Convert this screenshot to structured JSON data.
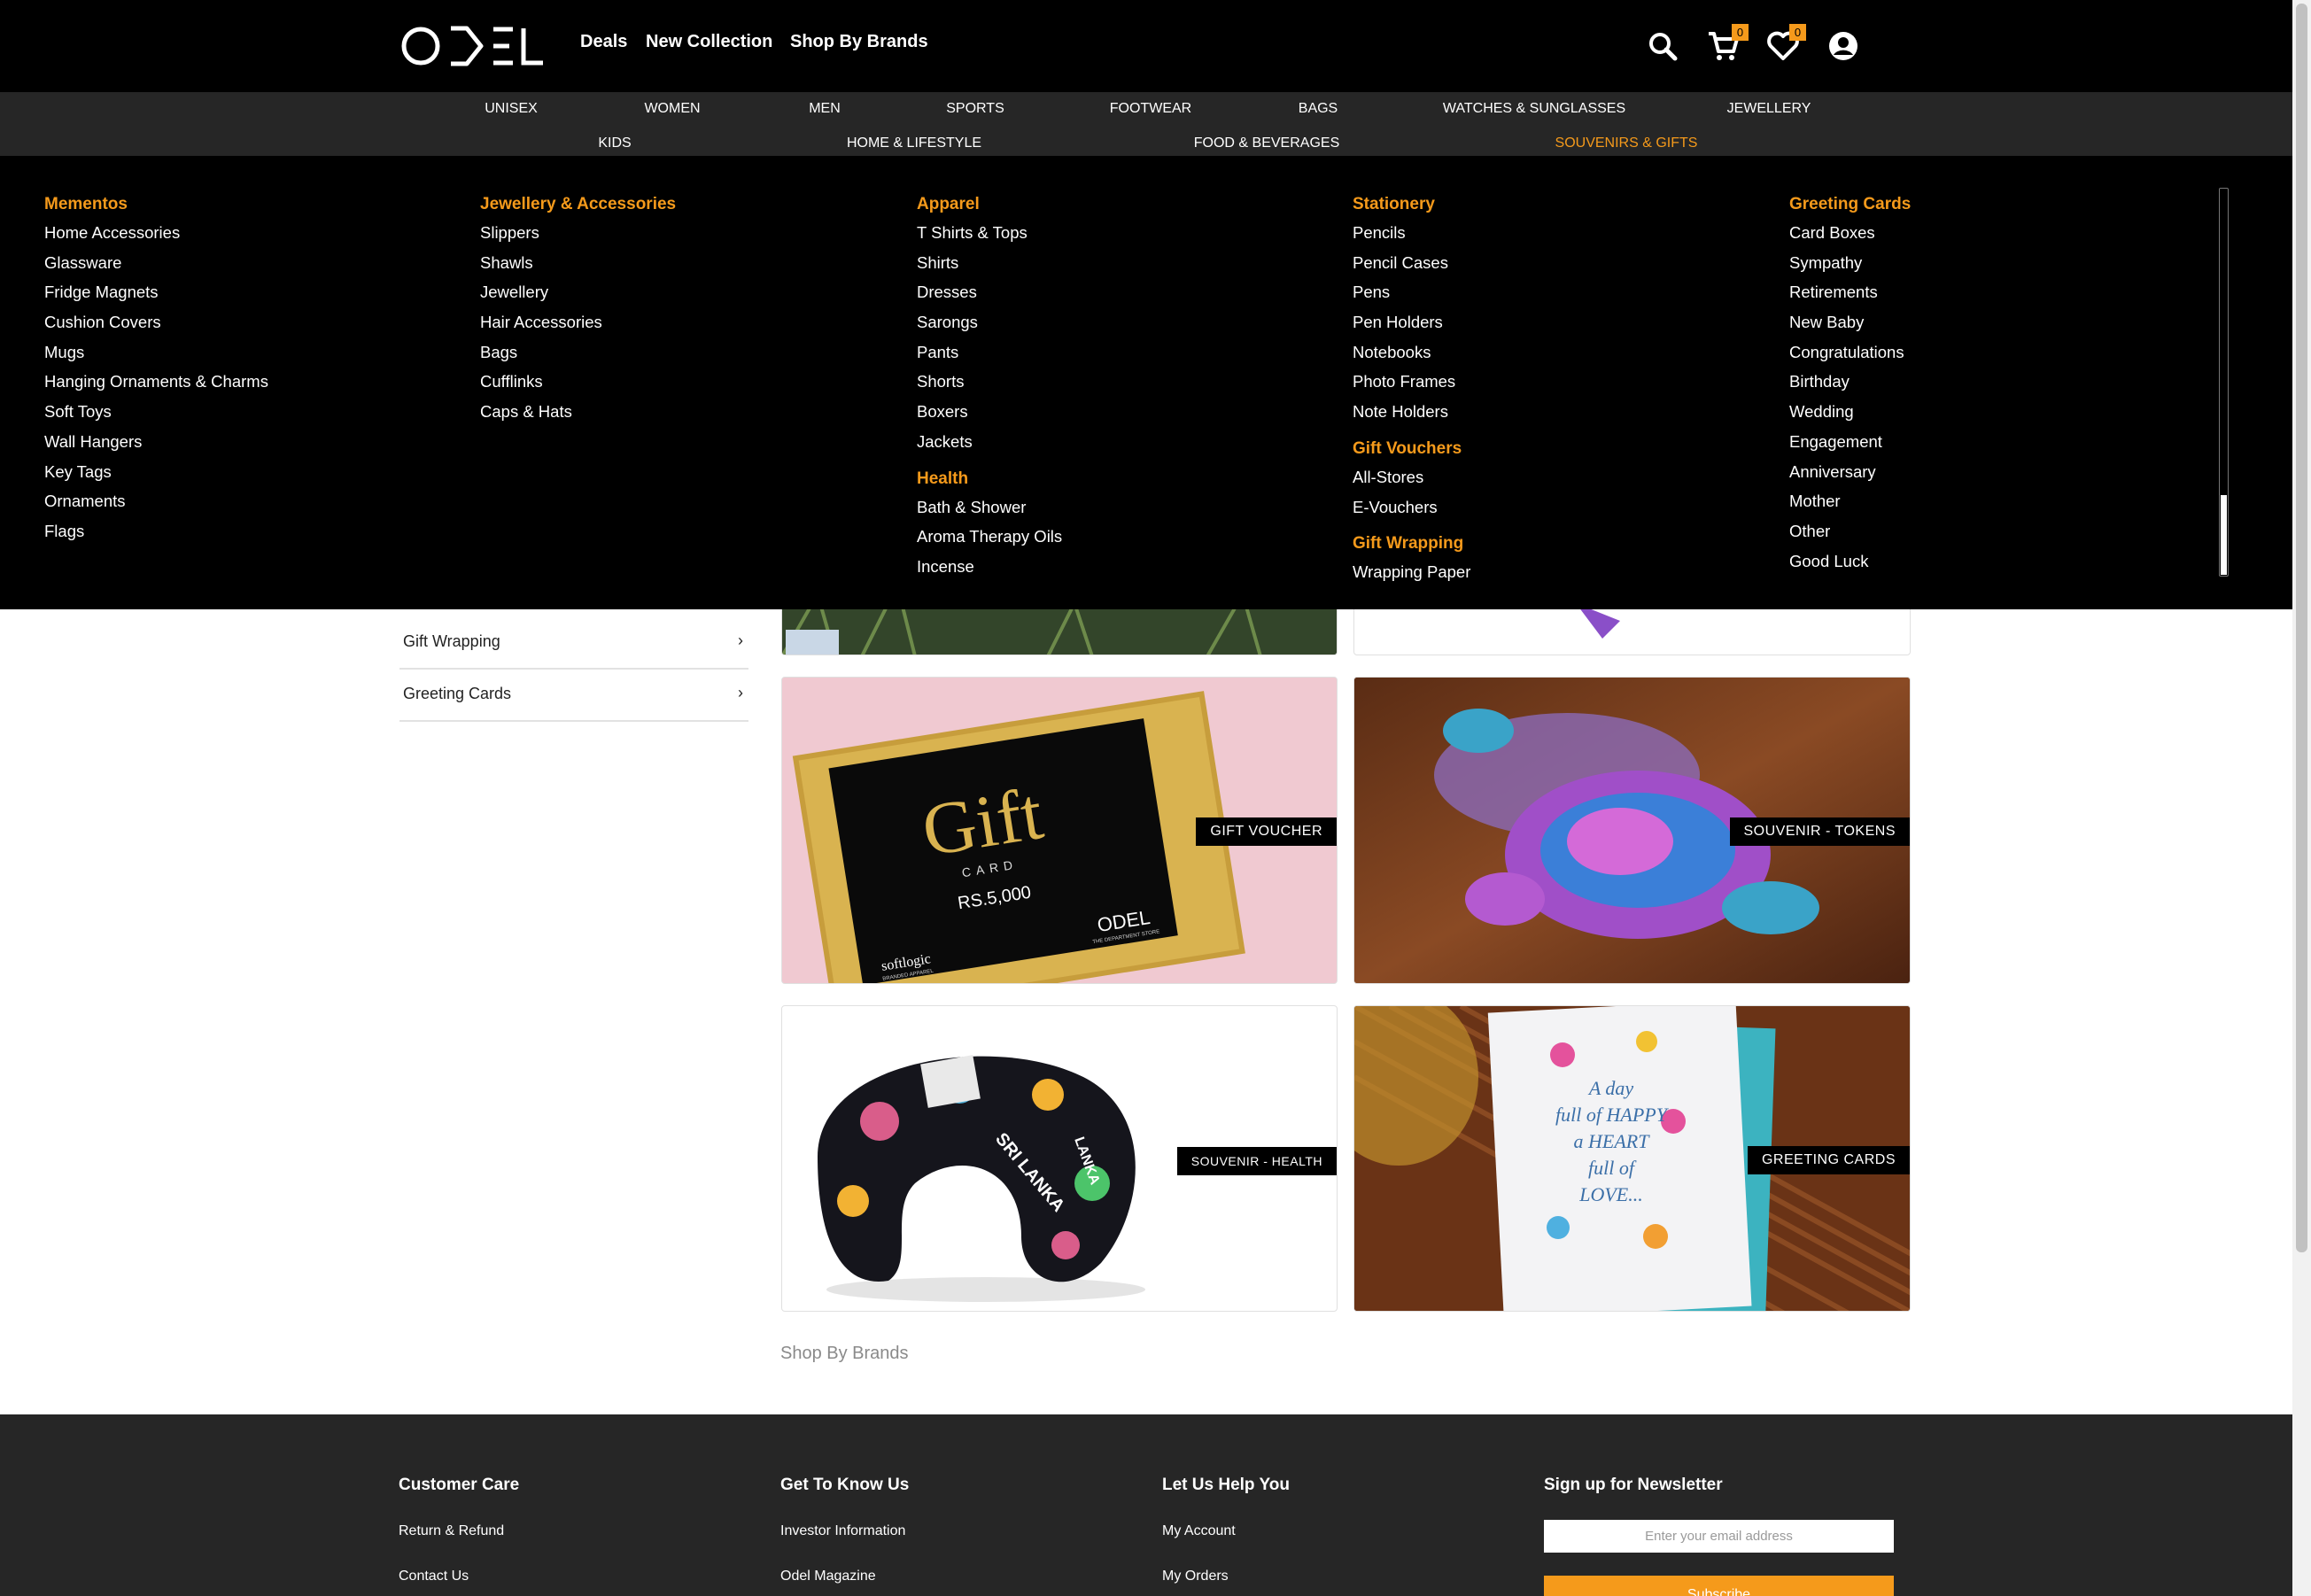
{
  "header": {
    "nav": [
      "Deals",
      "New Collection",
      "Shop By Brands"
    ],
    "cart_count": "0",
    "wishlist_count": "0",
    "icons": [
      "logo",
      "search-icon",
      "cart-icon",
      "heart-icon",
      "user-icon"
    ]
  },
  "categories": {
    "row1": [
      "UNISEX",
      "WOMEN",
      "MEN",
      "SPORTS",
      "FOOTWEAR",
      "BAGS",
      "WATCHES & SUNGLASSES",
      "JEWELLERY"
    ],
    "row2": [
      "KIDS",
      "HOME & LIFESTYLE",
      "FOOD & BEVERAGES",
      "SOUVENIRS & GIFTS"
    ],
    "active": "SOUVENIRS & GIFTS"
  },
  "mega_menu": {
    "col1": {
      "groups": [
        {
          "title": "Mementos",
          "items": [
            "Home Accessories",
            "Glassware",
            "Fridge Magnets",
            "Cushion Covers",
            "Mugs",
            "Hanging Ornaments & Charms",
            "Soft Toys",
            "Wall Hangers",
            "Key Tags",
            "Ornaments",
            "Flags"
          ]
        }
      ]
    },
    "col2": {
      "groups": [
        {
          "title": "Jewellery & Accessories",
          "items": [
            "Slippers",
            "Shawls",
            "Jewellery",
            "Hair Accessories",
            "Bags",
            "Cufflinks",
            "Caps & Hats"
          ]
        }
      ]
    },
    "col3": {
      "groups": [
        {
          "title": "Apparel",
          "items": [
            "T Shirts & Tops",
            "Shirts",
            "Dresses",
            "Sarongs",
            "Pants",
            "Shorts",
            "Boxers",
            "Jackets"
          ]
        },
        {
          "title": "Health",
          "items": [
            "Bath & Shower",
            "Aroma Therapy Oils",
            "Incense"
          ]
        }
      ]
    },
    "col4": {
      "groups": [
        {
          "title": "Stationery",
          "items": [
            "Pencils",
            "Pencil Cases",
            "Pens",
            "Pen Holders",
            "Notebooks",
            "Photo Frames",
            "Note Holders"
          ]
        },
        {
          "title": "Gift Vouchers",
          "items": [
            "All-Stores",
            "E-Vouchers"
          ]
        },
        {
          "title": "Gift Wrapping",
          "items": [
            "Wrapping Paper"
          ]
        }
      ]
    },
    "col5": {
      "groups": [
        {
          "title": "Greeting Cards",
          "items": [
            "Card Boxes",
            "Sympathy",
            "Retirements",
            "New Baby",
            "Congratulations",
            "Birthday",
            "Wedding",
            "Engagement",
            "Anniversary",
            "Mother",
            "Other",
            "Good Luck"
          ]
        }
      ]
    }
  },
  "sidebar": {
    "items": [
      {
        "label": "Gift Wrapping",
        "chevron": "›"
      },
      {
        "label": "Greeting Cards",
        "chevron": "›"
      }
    ]
  },
  "tiles": [
    {
      "label": "GIFT VOUCHER"
    },
    {
      "label": "SOUVENIR - TOKENS"
    },
    {
      "label": "SOUVENIR - HEALTH"
    },
    {
      "label": "GREETING CARDS"
    }
  ],
  "image_text": {
    "gift_card": {
      "word": "Gift",
      "sub": "CARD",
      "amount": "RS.5,000",
      "brand": "ODEL",
      "brand_sub": "THE DEPARTMENT STORE",
      "maker": "softlogic",
      "maker_sub": "BRANDED APPAREL"
    },
    "pillow": {
      "text1": "SRI LANKA",
      "text2": "LANKA"
    },
    "greeting": {
      "line1": "A day",
      "line2": "full of HAPPY",
      "line3": "a HEART",
      "line4": "full of",
      "line5": "LOVE..."
    }
  },
  "section": {
    "shop_by_brands": "Shop By Brands"
  },
  "footer": {
    "cols": [
      {
        "title": "Customer Care",
        "links": [
          "Return & Refund",
          "Contact Us"
        ]
      },
      {
        "title": "Get To Know Us",
        "links": [
          "Investor Information",
          "Odel Magazine"
        ]
      },
      {
        "title": "Let Us Help You",
        "links": [
          "My Account",
          "My Orders"
        ]
      }
    ],
    "newsletter": {
      "title": "Sign up for Newsletter",
      "placeholder": "Enter your email address",
      "button": "Subscribe"
    }
  },
  "colors": {
    "accent": "#f59a1b",
    "header_bg": "#000000",
    "catbar_bg": "#262626",
    "footer_bg": "#262626"
  }
}
